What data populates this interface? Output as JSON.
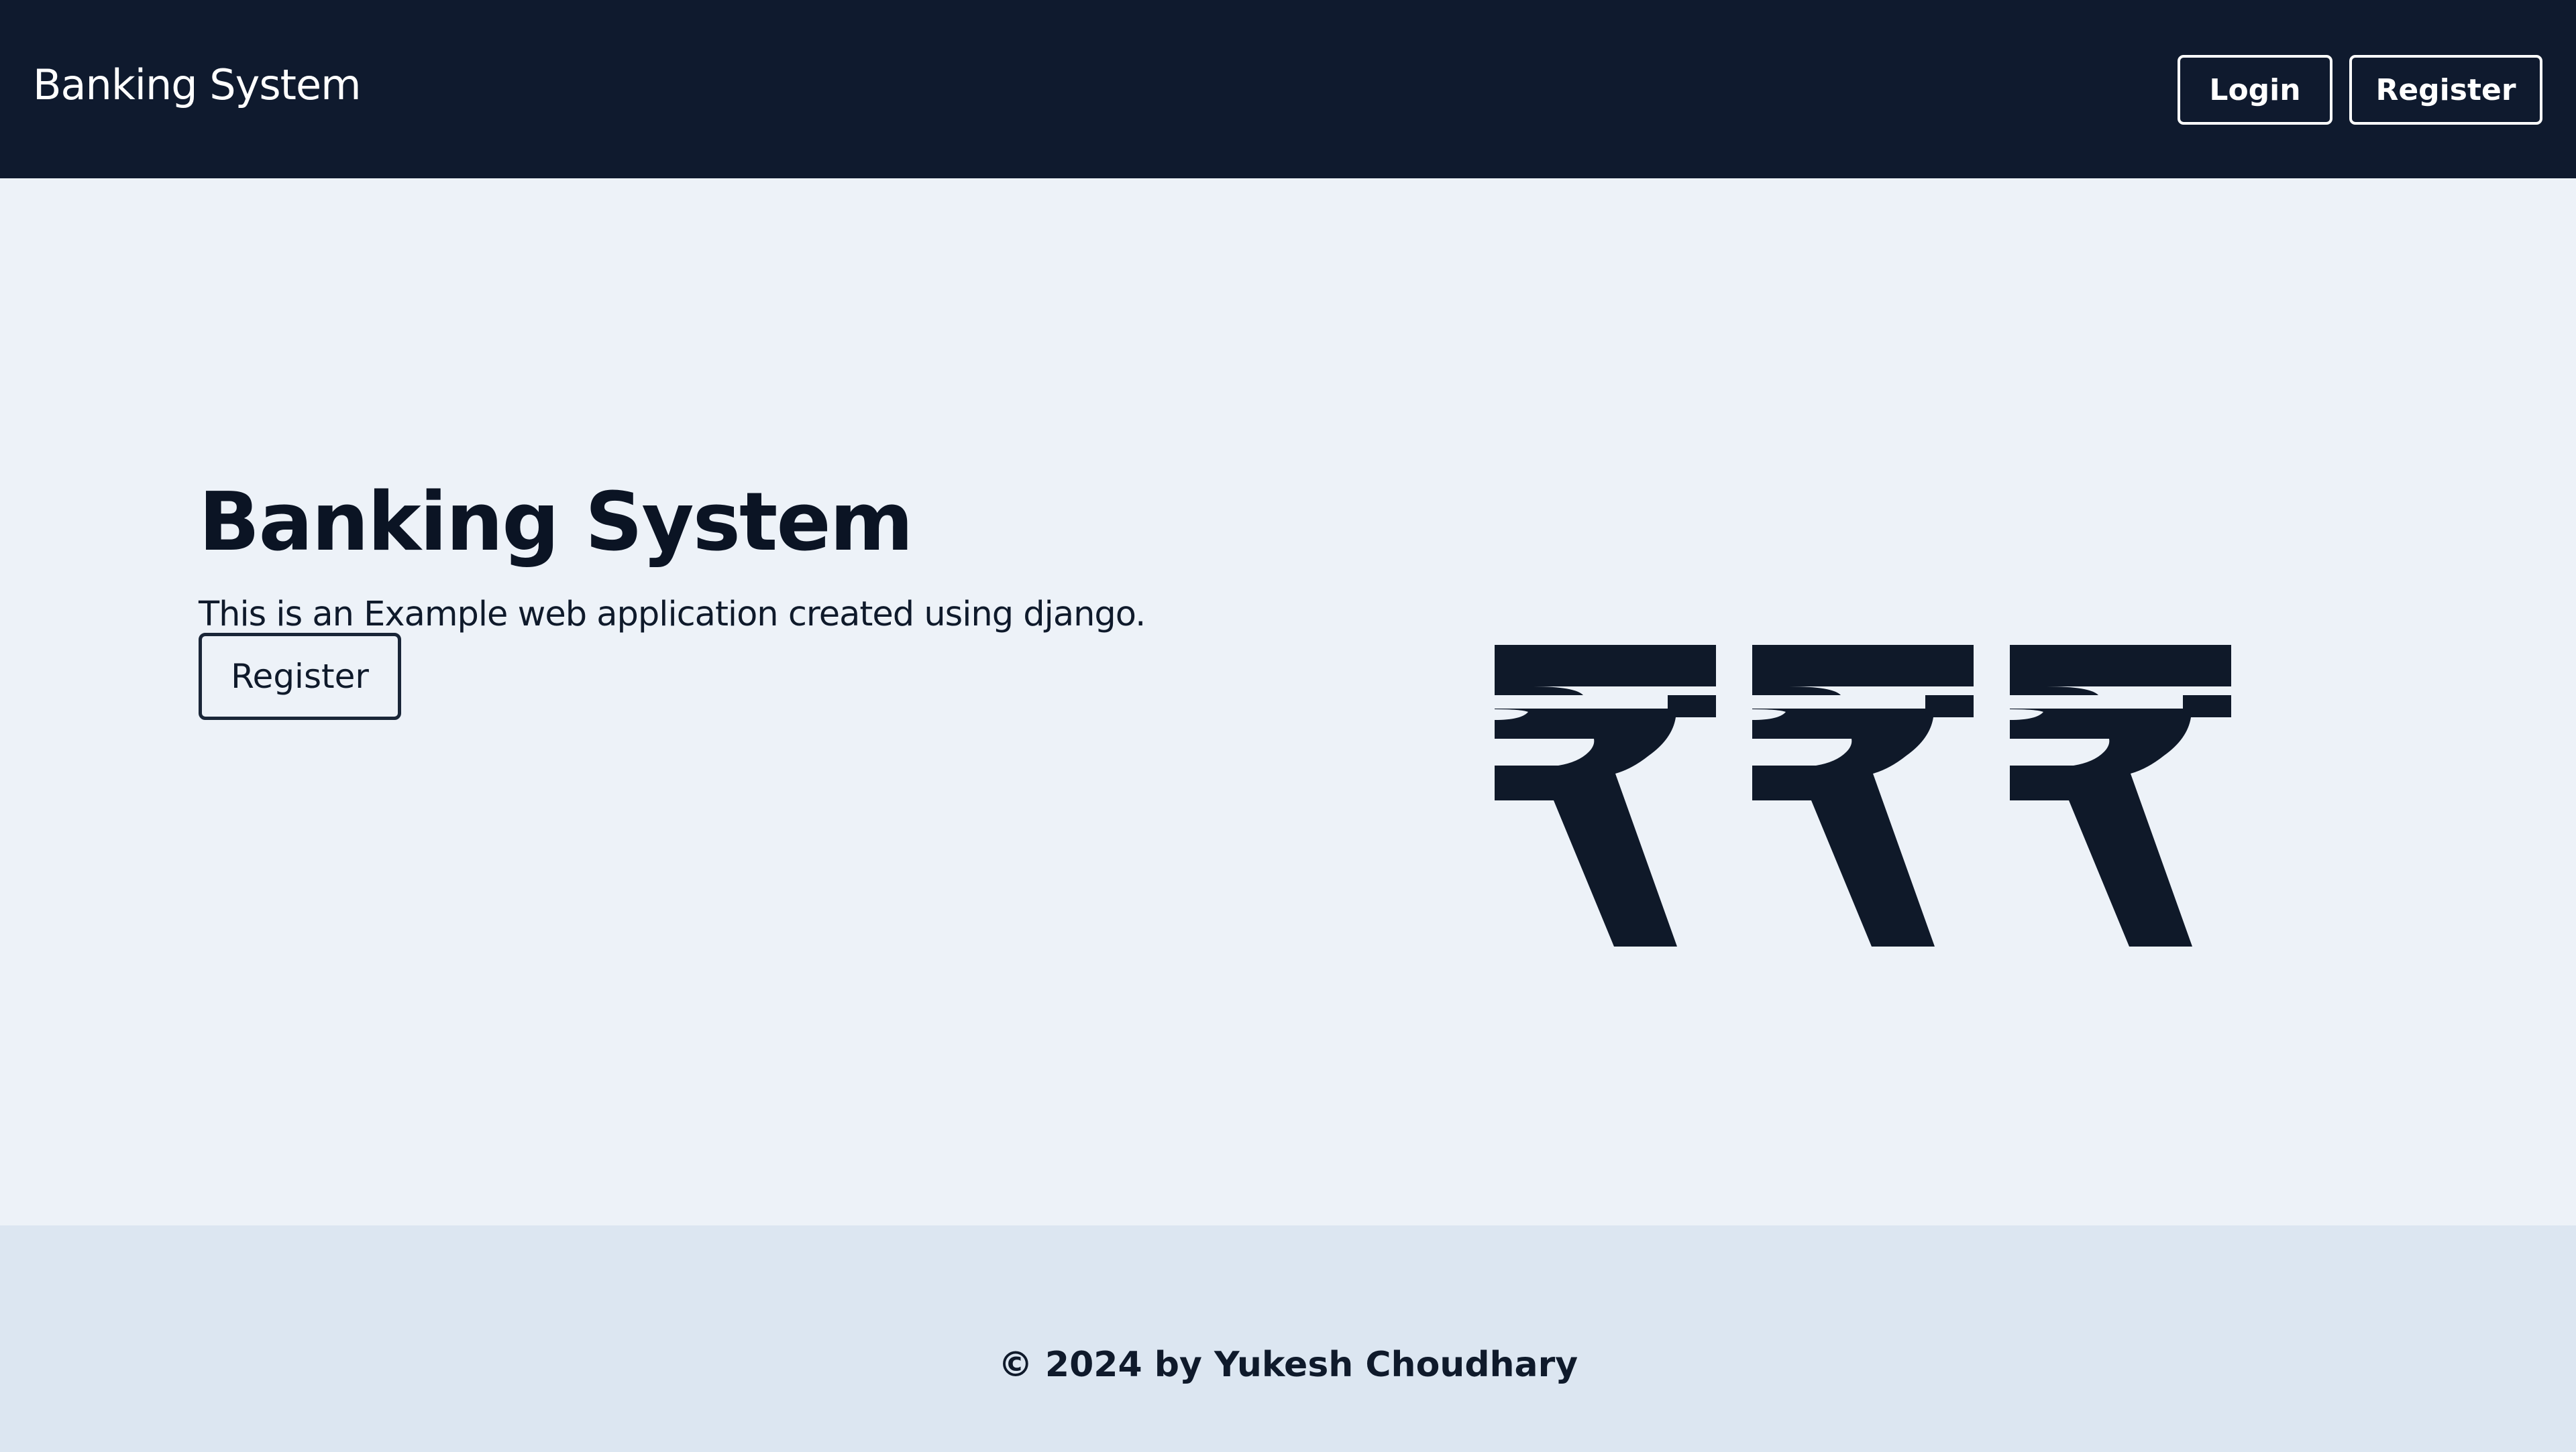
{
  "navbar": {
    "brand": "Banking System",
    "login_label": "Login",
    "register_label": "Register"
  },
  "hero": {
    "title": "Banking System",
    "description": "This is an Example web application created using django.",
    "register_label": "Register",
    "illustration": "rupee-icons"
  },
  "footer": {
    "copyright": "© 2024 by Yukesh Choudhary"
  },
  "colors": {
    "navbar_bg": "#0f1a2e",
    "page_bg": "#edf2f8",
    "footer_bg": "#dce6f1",
    "text": "#0f1a2b"
  }
}
